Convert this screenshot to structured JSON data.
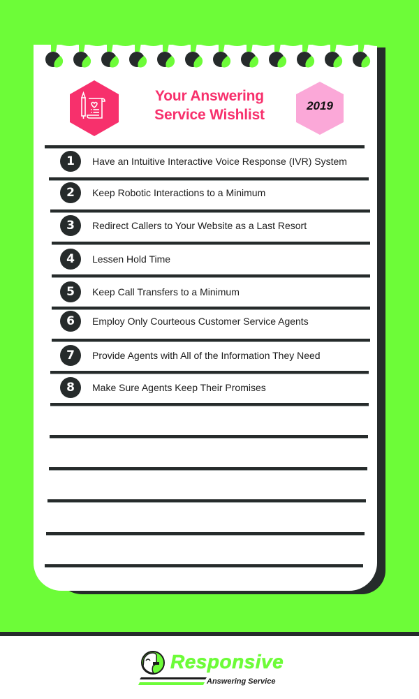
{
  "header": {
    "title_line1": "Your Answering",
    "title_line2": "Service Wishlist",
    "year": "2019",
    "icon": "wishlist-scroll-pen-icon"
  },
  "colors": {
    "background": "#6dfc38",
    "title": "#f7306c",
    "icon_hex": "#f7306c",
    "year_hex": "#fba8d8",
    "dark": "#262b2b"
  },
  "wishlist": {
    "items": [
      {
        "number": "1",
        "text": "Have an Intuitive Interactive Voice Response (IVR) System"
      },
      {
        "number": "2",
        "text": "Keep Robotic Interactions to a Minimum"
      },
      {
        "number": "3",
        "text": "Redirect Callers to Your Website as a Last Resort"
      },
      {
        "number": "4",
        "text": "Lessen Hold Time"
      },
      {
        "number": "5",
        "text": "Keep Call Transfers to a Minimum"
      },
      {
        "number": "6",
        "text": "Employ Only Courteous Customer Service Agents"
      },
      {
        "number": "7",
        "text": "Provide Agents with All of the Information They Need"
      },
      {
        "number": "8",
        "text": "Make Sure Agents Keep Their Promises"
      }
    ],
    "blank_lines": 5
  },
  "footer": {
    "brand": "Responsive",
    "tagline": "Answering Service",
    "logo_icon": "headset-person-icon"
  }
}
